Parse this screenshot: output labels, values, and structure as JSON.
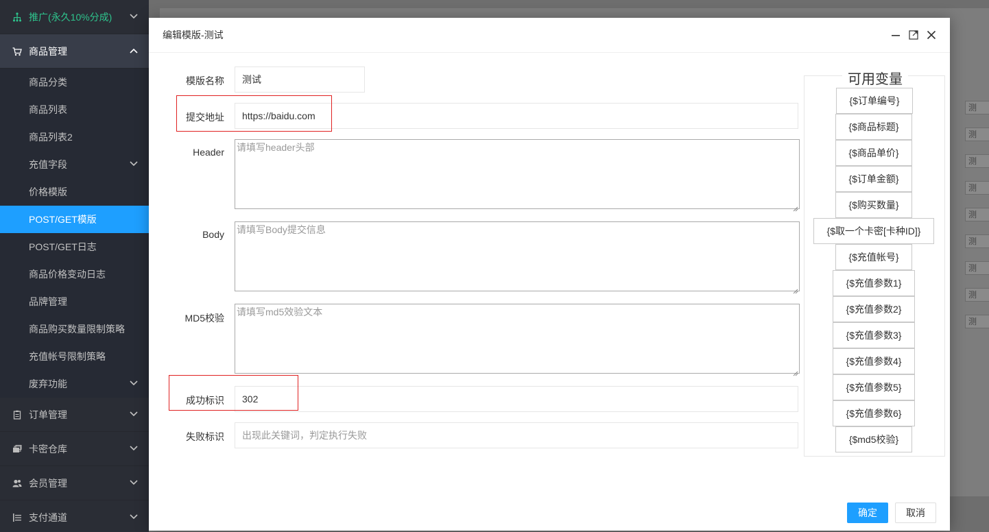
{
  "sidebar": {
    "promo": "推广(永久10%分成)",
    "product_mgmt": "商品管理",
    "items": [
      {
        "label": "商品分类"
      },
      {
        "label": "商品列表"
      },
      {
        "label": "商品列表2"
      },
      {
        "label": "充值字段"
      },
      {
        "label": "价格模版"
      },
      {
        "label": "POST/GET模版"
      },
      {
        "label": "POST/GET日志"
      },
      {
        "label": "商品价格变动日志"
      },
      {
        "label": "品牌管理"
      },
      {
        "label": "商品购买数量限制策略"
      },
      {
        "label": "充值帐号限制策略"
      },
      {
        "label": "废弃功能"
      }
    ],
    "order_mgmt": "订单管理",
    "card_store": "卡密仓库",
    "member_mgmt": "会员管理",
    "payment": "支付通道"
  },
  "background": {
    "row_button_label": "测"
  },
  "modal": {
    "title": "编辑模版-测试",
    "fields": {
      "name_label": "模版名称",
      "name_value": "测试",
      "url_label": "提交地址",
      "url_value": "https://baidu.com",
      "header_label": "Header",
      "header_placeholder": "请填写header头部",
      "body_label": "Body",
      "body_placeholder": "请填写Body提交信息",
      "md5_label": "MD5校验",
      "md5_placeholder": "请填写md5效验文本",
      "success_label": "成功标识",
      "success_value": "302",
      "fail_label": "失败标识",
      "fail_placeholder": "出现此关键词，判定执行失败"
    },
    "variables": {
      "title": "可用变量",
      "items": [
        "{$订单编号}",
        "{$商品标题}",
        "{$商品单价}",
        "{$订单金额}",
        "{$购买数量}",
        "{$取一个卡密[卡种ID]}",
        "{$充值帐号}",
        "{$充值参数1}",
        "{$充值参数2}",
        "{$充值参数3}",
        "{$充值参数4}",
        "{$充值参数5}",
        "{$充值参数6}",
        "{$md5校验}"
      ]
    },
    "buttons": {
      "ok": "确定",
      "cancel": "取消"
    }
  },
  "colors": {
    "sidebar_bg": "#20222a",
    "active_item": "#1e9fff",
    "promo_green": "#2ec48d",
    "highlight_red": "#e02020"
  }
}
